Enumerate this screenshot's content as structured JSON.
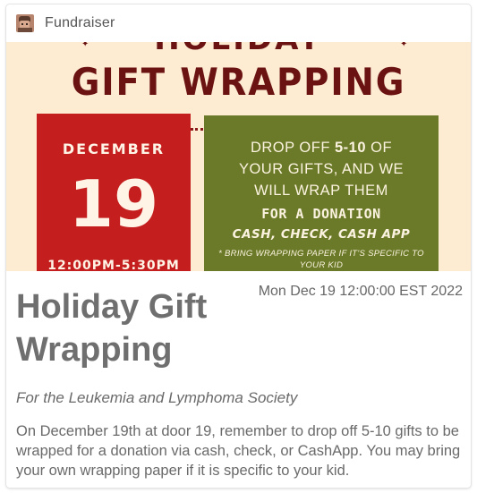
{
  "header": {
    "group_name": "Fundraiser"
  },
  "banner": {
    "top_text": "HOLIDAY",
    "title": "GIFT WRAPPING",
    "month": "DECEMBER",
    "day": "19",
    "time": "12:00PM-5:30PM",
    "drop_line_1_pre": "DROP OFF ",
    "drop_line_1_bold": "5-10",
    "drop_line_1_post": " OF",
    "drop_line_2": "YOUR GIFTS, AND WE",
    "drop_line_3": "WILL WRAP THEM",
    "donation": "FOR A DONATION",
    "methods": "CASH, CHECK, CASH APP",
    "note": "* BRING WRAPPING PAPER IF IT'S SPECIFIC TO YOUR KID",
    "colors": {
      "background": "#fdebd2",
      "title": "#6b1212",
      "red_box": "#c41e1e",
      "green_box": "#6b7a28"
    }
  },
  "event": {
    "date": "Mon Dec 19 12:00:00 EST 2022",
    "title": "Holiday Gift Wrapping",
    "subtitle": "For the Leukemia and Lymphoma Society",
    "description": "On December 19th at door 19, remember to drop off 5-10 gifts to be wrapped for a donation via cash, check, or CashApp. You may bring your own wrapping paper if it is specific to your kid."
  }
}
